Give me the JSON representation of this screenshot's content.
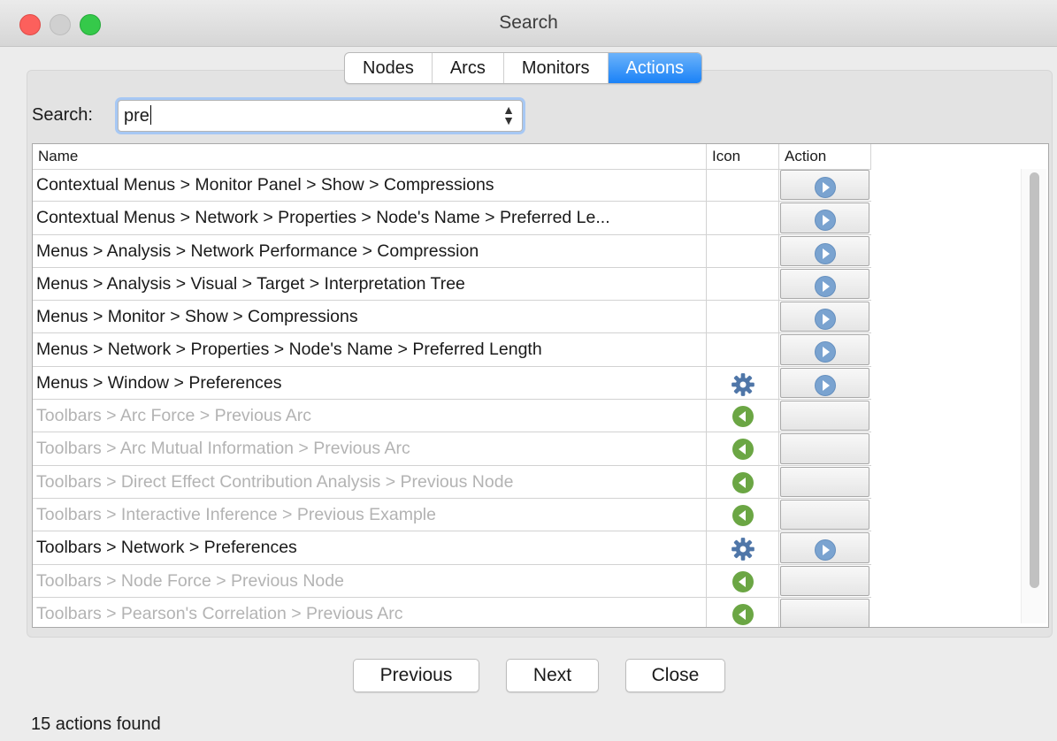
{
  "window": {
    "title": "Search"
  },
  "tabs": [
    {
      "label": "Nodes",
      "active": false
    },
    {
      "label": "Arcs",
      "active": false
    },
    {
      "label": "Monitors",
      "active": false
    },
    {
      "label": "Actions",
      "active": true
    }
  ],
  "search": {
    "label": "Search:",
    "value": "pre"
  },
  "table": {
    "columns": [
      "Name",
      "Icon",
      "Action"
    ],
    "rows": [
      {
        "name": "Contextual Menus > Monitor Panel > Show > Compressions",
        "enabled": true,
        "icon": "",
        "has_action": true
      },
      {
        "name": "Contextual Menus > Network > Properties > Node's Name > Preferred Le...",
        "enabled": true,
        "icon": "",
        "has_action": true
      },
      {
        "name": "Menus > Analysis > Network Performance > Compression",
        "enabled": true,
        "icon": "",
        "has_action": true
      },
      {
        "name": "Menus > Analysis > Visual > Target > Interpretation Tree",
        "enabled": true,
        "icon": "",
        "has_action": true
      },
      {
        "name": "Menus > Monitor > Show > Compressions",
        "enabled": true,
        "icon": "",
        "has_action": true
      },
      {
        "name": "Menus > Network > Properties > Node's Name > Preferred Length",
        "enabled": true,
        "icon": "",
        "has_action": true
      },
      {
        "name": "Menus > Window > Preferences",
        "enabled": true,
        "icon": "gear-icon",
        "has_action": true
      },
      {
        "name": "Toolbars > Arc Force > Previous Arc",
        "enabled": false,
        "icon": "previous-icon",
        "has_action": false
      },
      {
        "name": "Toolbars > Arc Mutual Information > Previous Arc",
        "enabled": false,
        "icon": "previous-icon",
        "has_action": false
      },
      {
        "name": "Toolbars > Direct Effect Contribution Analysis > Previous Node",
        "enabled": false,
        "icon": "previous-icon",
        "has_action": false
      },
      {
        "name": "Toolbars > Interactive Inference > Previous Example",
        "enabled": false,
        "icon": "previous-icon",
        "has_action": false
      },
      {
        "name": "Toolbars > Network > Preferences",
        "enabled": true,
        "icon": "gear-icon",
        "has_action": true
      },
      {
        "name": "Toolbars > Node Force > Previous Node",
        "enabled": false,
        "icon": "previous-icon",
        "has_action": false
      },
      {
        "name": "Toolbars > Pearson's Correlation > Previous Arc",
        "enabled": false,
        "icon": "previous-icon",
        "has_action": false
      }
    ]
  },
  "buttons": {
    "previous": "Previous",
    "next": "Next",
    "close": "Close"
  },
  "status": "15 actions found",
  "colors": {
    "accent": "#1a82f7",
    "play": "#7aa3d0",
    "back": "#6ba644",
    "gear": "#4f76a8"
  }
}
